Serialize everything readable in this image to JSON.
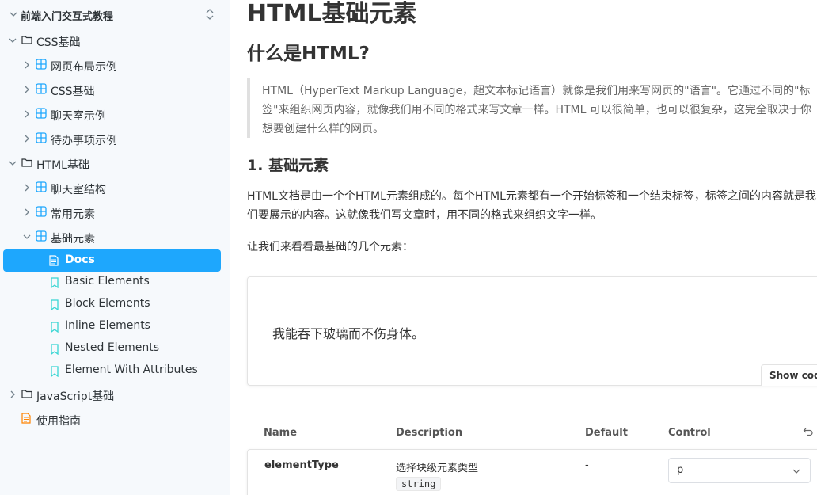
{
  "sidebar": {
    "title": "前端入门交互式教程",
    "css": {
      "label": "CSS基础",
      "items": [
        {
          "label": "网页布局示例"
        },
        {
          "label": "CSS基础"
        },
        {
          "label": "聊天室示例"
        },
        {
          "label": "待办事项示例"
        }
      ]
    },
    "html": {
      "label": "HTML基础",
      "items": [
        {
          "label": "聊天室结构"
        },
        {
          "label": "常用元素"
        },
        {
          "label": "基础元素"
        }
      ],
      "stories": [
        {
          "label": "Docs",
          "active": true
        },
        {
          "label": "Basic Elements"
        },
        {
          "label": "Block Elements"
        },
        {
          "label": "Inline Elements"
        },
        {
          "label": "Nested Elements"
        },
        {
          "label": "Element With Attributes"
        }
      ]
    },
    "js": {
      "label": "JavaScript基础"
    },
    "guide": {
      "label": "使用指南"
    }
  },
  "main": {
    "h1": "HTML基础元素",
    "h2": "什么是HTML?",
    "quote": "HTML（HyperText Markup Language，超文本标记语言）就像是我们用来写网页的\"语言\"。它通过不同的\"标签\"来组织网页内容，就像我们用不同的格式来写文章一样。HTML 可以很简单，也可以很复杂，这完全取决于你想要创建什么样的网页。",
    "h3": "1. 基础元素",
    "para1": "HTML文档是由一个个HTML元素组成的。每个HTML元素都有一个开始标签和一个结束标签，标签之间的内容就是我们要展示的内容。这就像我们写文章时，用不同的格式来组织文字一样。",
    "para2": "让我们来看看最基础的几个元素：",
    "demo_text": "我能吞下玻璃而不伤身体。",
    "show_code": "Show code",
    "args": {
      "headers": {
        "name": "Name",
        "description": "Description",
        "default": "Default",
        "control": "Control"
      },
      "rows": [
        {
          "name": "elementType",
          "description": "选择块级元素类型",
          "type": "string",
          "default": "-",
          "value": "p"
        }
      ]
    }
  },
  "colors": {
    "accent": "#1ea7fd",
    "component_icon": "#1ea7fd",
    "story_icon": "#37d5d3",
    "doc_icon_orange": "#ff8300"
  }
}
